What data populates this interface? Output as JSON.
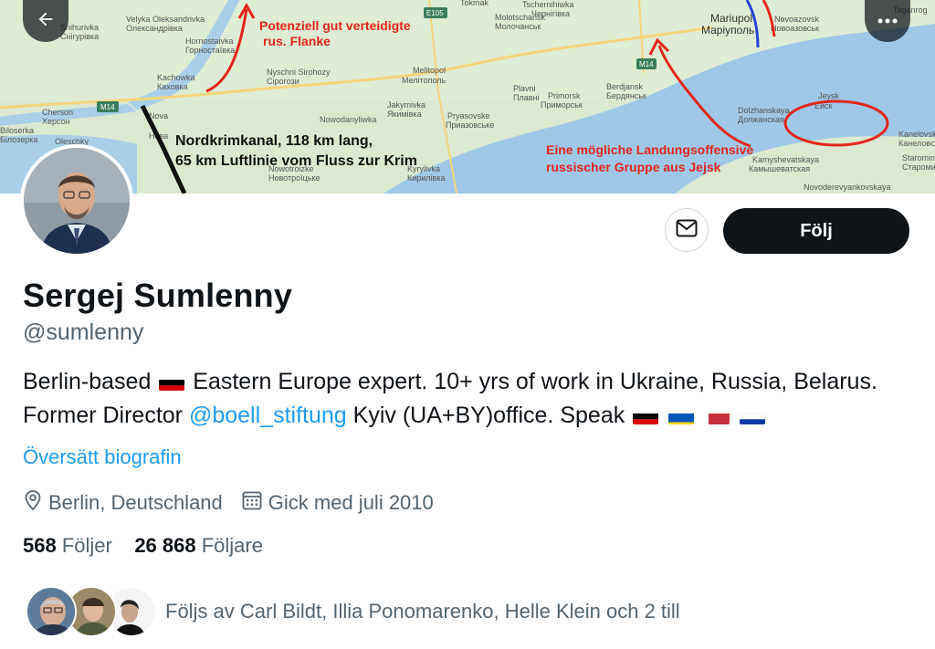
{
  "banner": {
    "annotations": [
      "Potenziell gut verteidigte",
      "rus. Flanke",
      "Nordkrimkanal, 118 km lang,",
      "65 km Luftlinie vom Fluss zur Krim",
      "Eine mögliche Landungsoffensive",
      "russischer Gruppe aus Jejsk"
    ],
    "places": [
      {
        "name": "Snihurivka",
        "alt": "Снігурівка"
      },
      {
        "name": "Velyka Oleksandrivka",
        "alt": "Олександрівка"
      },
      {
        "name": "Hornostaivka",
        "alt": "Горностаївка"
      },
      {
        "name": "Kachowka",
        "alt": "Каховка"
      },
      {
        "name": "Cherson",
        "alt": "Херсон"
      },
      {
        "name": "Nova",
        "alt": "Нова"
      },
      {
        "name": "Biloserka",
        "alt": "Білозерка"
      },
      {
        "name": "Oleschky",
        "alt": ""
      },
      {
        "name": "Melitopol",
        "alt": "Мелітополь"
      },
      {
        "name": "Nyschni Sirohozy",
        "alt": "Сірогози"
      },
      {
        "name": "Berdjansk",
        "alt": "Бердянськ"
      },
      {
        "name": "Mariupol",
        "alt": "Маріуполь"
      },
      {
        "name": "Novoazovsk",
        "alt": "Новоазовськ"
      },
      {
        "name": "Primorsk",
        "alt": "Приморськ"
      },
      {
        "name": "Jeysk",
        "alt": "Ейск"
      },
      {
        "name": "Dolzhanskaya",
        "alt": "Должанская"
      },
      {
        "name": "Kamyshevatskaya",
        "alt": "Камышеватская"
      },
      {
        "name": "Novoderevyankovskaya",
        "alt": ""
      },
      {
        "name": "Molotschansk",
        "alt": "Молочанськ"
      },
      {
        "name": "Tokmak",
        "alt": "Токмак"
      },
      {
        "name": "Tschernihiwka",
        "alt": "Чернігівка"
      },
      {
        "name": "Taganrog",
        "alt": ""
      },
      {
        "name": "Kanelovska",
        "alt": "Канеловская"
      },
      {
        "name": "Starominskaya",
        "alt": "Старомин"
      },
      {
        "name": "Kyrylivka",
        "alt": "Кирилівка"
      },
      {
        "name": "Pryasovske",
        "alt": "Приазовське"
      },
      {
        "name": "Jakymivka",
        "alt": "Якимівка"
      },
      {
        "name": "Nowodanyliwka",
        "alt": ""
      },
      {
        "name": "Nowotroizke",
        "alt": "Новотроїцьке"
      },
      {
        "name": "Plavni",
        "alt": "Плавні"
      }
    ],
    "roads": [
      "M14",
      "M14",
      "E105"
    ],
    "colors": {
      "sea": "#9fc8e8",
      "land": "#d9e8cf",
      "annotation_red": "#e3261a",
      "arrow_blue": "#2b44d6"
    }
  },
  "header": {
    "back_icon": "arrow-left-icon",
    "more_icon": "more-horizontal-icon"
  },
  "actions": {
    "message_icon": "envelope-icon",
    "follow_label": "Följ"
  },
  "profile": {
    "display_name": "Sergej Sumlenny",
    "handle": "@sumlenny",
    "bio": {
      "part1": "Berlin-based",
      "part2": "Eastern Europe expert. 10+ yrs of work in Ukraine, Russia, Belarus. Former Director",
      "mention": "@boell_stiftung",
      "part3": "Kyiv (UA+BY)office. Speak",
      "flags": [
        "Germany",
        "Ukraine",
        "Belarus",
        "Russia"
      ]
    },
    "translate_label": "Översätt biografin",
    "location": "Berlin, Deutschland",
    "joined": "Gick med juli 2010",
    "following_count": "568",
    "following_label": "Följer",
    "followers_count": "26 868",
    "followers_label": "Följare",
    "followed_by": "Följs av Carl Bildt, Illia Ponomarenko, Helle Klein och 2 till"
  },
  "colors": {
    "accent": "#1d9bf0",
    "text": "#0f1419",
    "secondary": "#536471",
    "button": "#0f1419"
  }
}
